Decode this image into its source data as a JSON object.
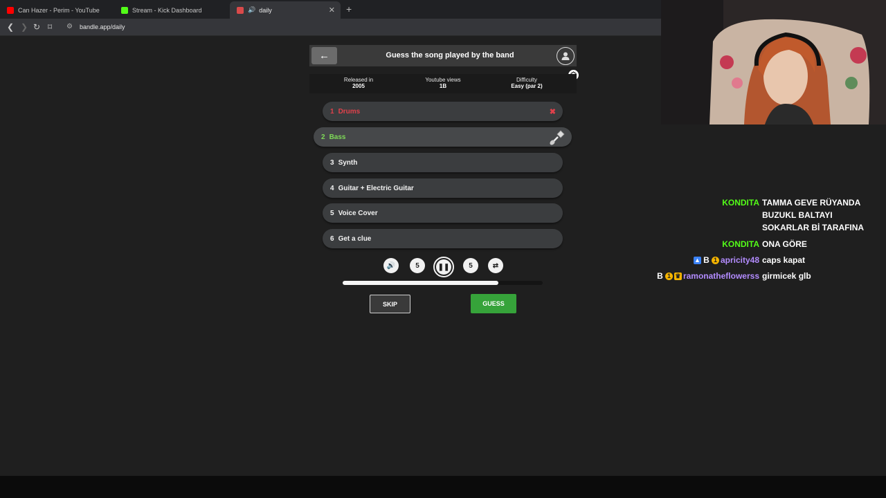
{
  "browser": {
    "tabs": [
      {
        "label": "Can Hazer - Perim - YouTube",
        "color": "#ff0000",
        "active": false
      },
      {
        "label": "Stream - Kick Dashboard",
        "color": "#53fc18",
        "active": false
      },
      {
        "label": "daily",
        "color": "#d94a4a",
        "active": true
      }
    ],
    "url": "bandle.app/daily"
  },
  "game": {
    "title": "Guess the song played by the band",
    "info": [
      {
        "label": "Released in",
        "value": "2005"
      },
      {
        "label": "Youtube views",
        "value": "1B"
      },
      {
        "label": "Difficulty",
        "value": "Easy (par 2)"
      }
    ],
    "instruments": [
      {
        "num": "1",
        "label": "Drums",
        "state": "wrong"
      },
      {
        "num": "2",
        "label": "Bass",
        "state": "current"
      },
      {
        "num": "3",
        "label": "Synth",
        "state": "locked"
      },
      {
        "num": "4",
        "label": "Guitar + Electric Guitar",
        "state": "locked"
      },
      {
        "num": "5",
        "label": "Voice Cover",
        "state": "locked"
      },
      {
        "num": "6",
        "label": "Get a clue",
        "state": "locked"
      }
    ],
    "rewind_label": "5",
    "forward_label": "5",
    "progress": 0.78,
    "skip_label": "SKIP",
    "guess_label": "GUESS",
    "colors": {
      "wrong": "#e0414b",
      "current": "#7ed957",
      "guess": "#36a33a"
    }
  },
  "chat": [
    {
      "user": "KONDITA",
      "color": "#53fc18",
      "lines": [
        "TAMMA GEVE RÜYANDA",
        "BUZUKL BALTAYI",
        "SOKARLAR Bİ TARAFINA"
      ]
    },
    {
      "user": "KONDITA",
      "color": "#53fc18",
      "lines": [
        "ONA GÖRE"
      ]
    },
    {
      "user": "apricity48",
      "color": "#b38cff",
      "lines": [
        "caps kapat"
      ]
    },
    {
      "user": "ramonatheflowerss",
      "color": "#b38cff",
      "lines": [
        "girmicek glb"
      ]
    }
  ]
}
